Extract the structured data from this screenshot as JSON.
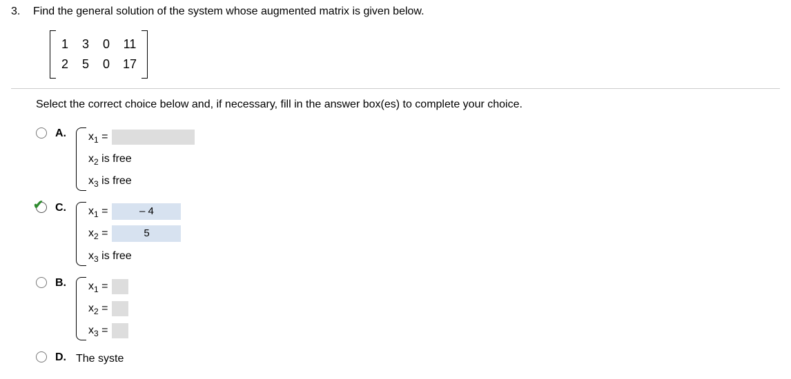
{
  "question": {
    "number": "3.",
    "prompt": "Find the general solution of the system whose augmented matrix is given below."
  },
  "matrix": {
    "rows": [
      [
        "1",
        "3",
        "0",
        "11"
      ],
      [
        "2",
        "5",
        "0",
        "17"
      ]
    ]
  },
  "instruction": "Select the correct choice below and, if necessary, fill in the answer box(es) to complete your choice.",
  "vars": {
    "x": "x",
    "eq": " =",
    "isfree": " is free"
  },
  "choices": {
    "A": {
      "letter": "A."
    },
    "B": {
      "letter": "B."
    },
    "C": {
      "letter": "C.",
      "x1_val": "– 4",
      "x2_val": "5"
    },
    "D": {
      "letter": "D.",
      "text": "The syste"
    }
  },
  "subs": {
    "s1": "1",
    "s2": "2",
    "s3": "3"
  }
}
